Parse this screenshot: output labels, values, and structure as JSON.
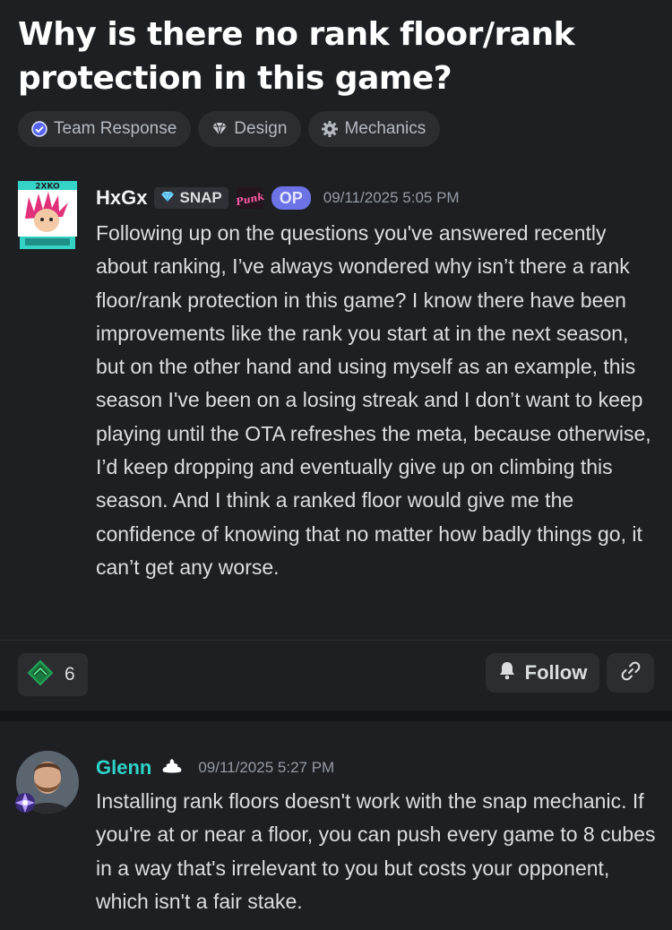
{
  "thread": {
    "title": "Why is there no rank floor/rank protection in this game?",
    "tags": [
      {
        "label": "Team Response",
        "icon": "verified-check-icon"
      },
      {
        "label": "Design",
        "icon": "gem-emoji-icon"
      },
      {
        "label": "Mechanics",
        "icon": "gear-icon"
      }
    ]
  },
  "post": {
    "author": "HxGx",
    "server_tag": "SNAP",
    "punk_badge": "Punk",
    "op_label": "OP",
    "timestamp": "09/11/2025 5:05 PM",
    "body": "Following up on the questions you've answered recently about ranking, I’ve always wondered why isn’t there a rank floor/rank protection in this game? I know there have been improvements like the rank you start at in the next season, but on the other hand and using myself as an example, this season I've been on a losing streak and I don’t want to keep playing until the OTA refreshes the meta, because otherwise, I’d keep dropping and eventually give up on climbing this season. And I think a ranked floor would give me the confidence of knowing that no matter how badly things go, it can’t get any worse.",
    "reaction_count": "6",
    "follow_label": "Follow"
  },
  "reply": {
    "author": "Glenn",
    "timestamp": "09/11/2025 5:27 PM",
    "body": "Installing rank floors doesn't work with the snap mechanic. If you're at or near a floor, you can push every game to 8 cubes in a way that's irrelevant to you but costs your opponent, which isn't a fair stake."
  },
  "colors": {
    "background": "#1e1f23",
    "op_badge": "#6b73e6",
    "reply_author": "#2ed3c7",
    "reaction_accent": "#23a55a"
  }
}
